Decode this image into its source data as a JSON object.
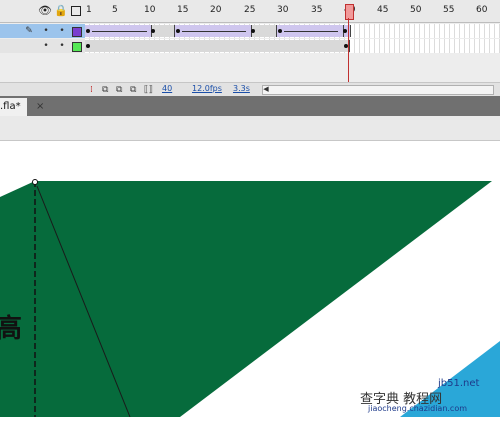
{
  "timeline": {
    "header_icons": [
      "eye-icon",
      "lock-icon",
      "outline-icon"
    ],
    "ruler_labels": [
      "1",
      "5",
      "10",
      "15",
      "20",
      "25",
      "30",
      "35",
      "40",
      "45",
      "50",
      "55",
      "60"
    ],
    "current_frame": "40",
    "fps": "12.0fps",
    "elapsed": "3.3s",
    "layers": [
      {
        "name": "",
        "selected": true,
        "color": "#7a3fcf"
      },
      {
        "name": "",
        "selected": false,
        "color": "#55e855"
      }
    ]
  },
  "document": {
    "tab_label": ".fla*",
    "close_label": "×"
  },
  "stage": {
    "shape_color": "#066b3c",
    "side_char": "高"
  },
  "watermark": {
    "site": "jb51.net",
    "cn": "查字典 教程网",
    "url": "jiaocheng.chazidian.com"
  },
  "colors": {
    "selected_row": "#9cc4ec",
    "playhead": "#f19a9a",
    "tween": "#cfc6ee"
  }
}
